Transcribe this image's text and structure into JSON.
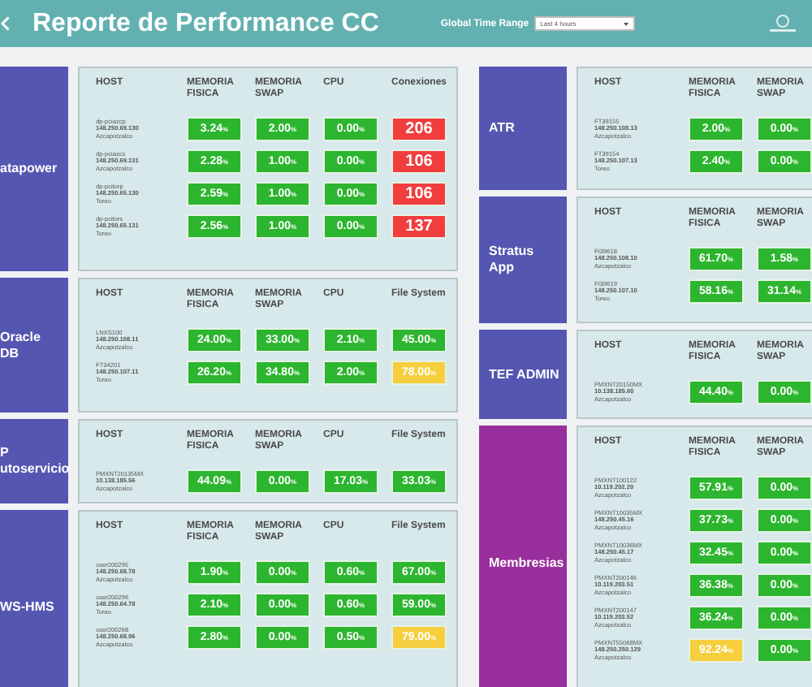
{
  "header": {
    "title": "Reporte de Performance CC",
    "time_range": {
      "label": "Global Time Range",
      "value": "Last 4 hours"
    }
  },
  "left_groups": [
    {
      "label": [
        "atapower"
      ],
      "color": "#5456b1",
      "columns": [
        "HOST",
        "MEMORIA FISICA",
        "MEMORIA SWAP",
        "CPU",
        "Conexiones"
      ],
      "rows": [
        {
          "host": "dp-pciazcp",
          "ip": "148.250.69.130",
          "site": "Azcapotzalco",
          "values": [
            {
              "value": "3.24",
              "unit": "%",
              "color": "#2cb52e"
            },
            {
              "value": "2.00",
              "unit": "%",
              "color": "#2cb52e"
            },
            {
              "value": "0.00",
              "unit": "%",
              "color": "#2cb52e"
            },
            {
              "value": "206",
              "color": "#f23d3f"
            }
          ]
        },
        {
          "host": "dp-pciazcs",
          "ip": "148.250.69.131",
          "site": "Azcapotzalco",
          "values": [
            {
              "value": "2.28",
              "unit": "%",
              "color": "#2cb52e"
            },
            {
              "value": "1.00",
              "unit": "%",
              "color": "#2cb52e"
            },
            {
              "value": "0.00",
              "unit": "%",
              "color": "#2cb52e"
            },
            {
              "value": "106",
              "color": "#f23d3f"
            }
          ]
        },
        {
          "host": "dp-pcitorp",
          "ip": "148.250.65.130",
          "site": "Toreo",
          "values": [
            {
              "value": "2.59",
              "unit": "%",
              "color": "#2cb52e"
            },
            {
              "value": "1.00",
              "unit": "%",
              "color": "#2cb52e"
            },
            {
              "value": "0.00",
              "unit": "%",
              "color": "#2cb52e"
            },
            {
              "value": "106",
              "color": "#f23d3f"
            }
          ]
        },
        {
          "host": "dp-pcitors",
          "ip": "148.250.65.131",
          "site": "Toreo",
          "values": [
            {
              "value": "2.56",
              "unit": "%",
              "color": "#2cb52e"
            },
            {
              "value": "1.00",
              "unit": "%",
              "color": "#2cb52e"
            },
            {
              "value": "0.00",
              "unit": "%",
              "color": "#2cb52e"
            },
            {
              "value": "137",
              "color": "#f23d3f"
            }
          ]
        }
      ]
    },
    {
      "label": [
        "Oracle",
        "DB"
      ],
      "color": "#5456b1",
      "columns": [
        "HOST",
        "MEMORIA FISICA",
        "MEMORIA SWAP",
        "CPU",
        "File System"
      ],
      "rows": [
        {
          "host": "LNXS100",
          "ip": "148.250.108.11",
          "site": "Azcapotzalco",
          "values": [
            {
              "value": "24.00",
              "unit": "%",
              "color": "#2cb52e"
            },
            {
              "value": "33.00",
              "unit": "%",
              "color": "#2cb52e"
            },
            {
              "value": "2.10",
              "unit": "%",
              "color": "#2cb52e"
            },
            {
              "value": "45.00",
              "unit": "%",
              "color": "#2cb52e"
            }
          ]
        },
        {
          "host": "FT34201",
          "ip": "148.250.107.11",
          "site": "Toreo",
          "values": [
            {
              "value": "26.20",
              "unit": "%",
              "color": "#2cb52e"
            },
            {
              "value": "34.80",
              "unit": "%",
              "color": "#2cb52e"
            },
            {
              "value": "2.00",
              "unit": "%",
              "color": "#2cb52e"
            },
            {
              "value": "78.00",
              "unit": "%",
              "color": "#f6cf3f"
            }
          ]
        }
      ]
    },
    {
      "label": [
        "P",
        "utoservicio"
      ],
      "color": "#5456b1",
      "columns": [
        "HOST",
        "MEMORIA FISICA",
        "MEMORIA SWAP",
        "CPU",
        "File System"
      ],
      "rows": [
        {
          "host": "PMXNT20135MX",
          "ip": "10.138.185.56",
          "site": "Azcapotzalco",
          "values": [
            {
              "value": "44.09",
              "unit": "%",
              "color": "#2cb52e"
            },
            {
              "value": "0.00",
              "unit": "%",
              "color": "#2cb52e"
            },
            {
              "value": "17.03",
              "unit": "%",
              "color": "#2cb52e"
            },
            {
              "value": "33.03",
              "unit": "%",
              "color": "#2cb52e"
            }
          ]
        }
      ]
    },
    {
      "label": [
        "WS-HMS"
      ],
      "color": "#5456b1",
      "columns": [
        "HOST",
        "MEMORIA FISICA",
        "MEMORIA SWAP",
        "CPU",
        "File System"
      ],
      "rows": [
        {
          "host": "oser200295",
          "ip": "148.250.68.78",
          "site": "Azcapotzalco",
          "values": [
            {
              "value": "1.90",
              "unit": "%",
              "color": "#2cb52e"
            },
            {
              "value": "0.00",
              "unit": "%",
              "color": "#2cb52e"
            },
            {
              "value": "0.60",
              "unit": "%",
              "color": "#2cb52e"
            },
            {
              "value": "67.00",
              "unit": "%",
              "color": "#2cb52e"
            }
          ]
        },
        {
          "host": "oser200296",
          "ip": "148.250.64.78",
          "site": "Toreo",
          "values": [
            {
              "value": "2.10",
              "unit": "%",
              "color": "#2cb52e"
            },
            {
              "value": "0.00",
              "unit": "%",
              "color": "#2cb52e"
            },
            {
              "value": "0.60",
              "unit": "%",
              "color": "#2cb52e"
            },
            {
              "value": "59.00",
              "unit": "%",
              "color": "#2cb52e"
            }
          ]
        },
        {
          "host": "oser200268",
          "ip": "148.250.68.96",
          "site": "Azcapotzalco",
          "values": [
            {
              "value": "2.80",
              "unit": "%",
              "color": "#2cb52e"
            },
            {
              "value": "0.00",
              "unit": "%",
              "color": "#2cb52e"
            },
            {
              "value": "0.50",
              "unit": "%",
              "color": "#2cb52e"
            },
            {
              "value": "79.00",
              "unit": "%",
              "color": "#f6cf3f"
            }
          ]
        }
      ]
    }
  ],
  "right_groups": [
    {
      "label": [
        "ATR"
      ],
      "color": "#5456b1",
      "columns": [
        "HOST",
        "MEMORIA FISICA",
        "MEMORIA SWAP"
      ],
      "rows": [
        {
          "host": "FT39155",
          "ip": "148.250.108.13",
          "site": "Azcapotzalco",
          "values": [
            {
              "value": "2.00",
              "unit": "%",
              "color": "#2cb52e"
            },
            {
              "value": "0.00",
              "unit": "%",
              "color": "#2cb52e"
            }
          ]
        },
        {
          "host": "FT39154",
          "ip": "148.250.107.13",
          "site": "Toreo",
          "values": [
            {
              "value": "2.40",
              "unit": "%",
              "color": "#2cb52e"
            },
            {
              "value": "0.00",
              "unit": "%",
              "color": "#2cb52e"
            }
          ]
        }
      ]
    },
    {
      "label": [
        "Stratus",
        "App"
      ],
      "color": "#5456b1",
      "columns": [
        "HOST",
        "MEMORIA FISICA",
        "MEMORIA SWAP"
      ],
      "rows": [
        {
          "host": "FI39618",
          "ip": "148.250.108.10",
          "site": "Azcapotzalco",
          "values": [
            {
              "value": "61.70",
              "unit": "%",
              "color": "#2cb52e"
            },
            {
              "value": "1.58",
              "unit": "%",
              "color": "#2cb52e"
            }
          ]
        },
        {
          "host": "FI39619",
          "ip": "148.250.107.10",
          "site": "Toreo",
          "values": [
            {
              "value": "58.16",
              "unit": "%",
              "color": "#2cb52e"
            },
            {
              "value": "31.14",
              "unit": "%",
              "color": "#2cb52e"
            }
          ]
        }
      ]
    },
    {
      "label": [
        "TEF ADMIN"
      ],
      "color": "#5456b1",
      "columns": [
        "HOST",
        "MEMORIA FISICA",
        "MEMORIA SWAP"
      ],
      "rows": [
        {
          "host": "PMXNT20150MX",
          "ip": "10.138.185.60",
          "site": "Azcapotzalco",
          "values": [
            {
              "value": "44.40",
              "unit": "%",
              "color": "#2cb52e"
            },
            {
              "value": "0.00",
              "unit": "%",
              "color": "#2cb52e"
            }
          ]
        }
      ]
    },
    {
      "label": [
        "Membresias"
      ],
      "color": "#992f9c",
      "columns": [
        "HOST",
        "MEMORIA FISICA",
        "MEMORIA SWAP"
      ],
      "rows": [
        {
          "host": "PMXNT100122",
          "ip": "10.119.202.20",
          "site": "Azcapotzalco",
          "values": [
            {
              "value": "57.91",
              "unit": "%",
              "color": "#2cb52e"
            },
            {
              "value": "0.00",
              "unit": "%",
              "color": "#2cb52e"
            }
          ]
        },
        {
          "host": "PMXNT10035MX",
          "ip": "148.250.45.16",
          "site": "Azcapotzalco",
          "values": [
            {
              "value": "37.73",
              "unit": "%",
              "color": "#2cb52e"
            },
            {
              "value": "0.00",
              "unit": "%",
              "color": "#2cb52e"
            }
          ]
        },
        {
          "host": "PMXNT10036MX",
          "ip": "148.250.45.17",
          "site": "Azcapotzalco",
          "values": [
            {
              "value": "32.45",
              "unit": "%",
              "color": "#2cb52e"
            },
            {
              "value": "0.00",
              "unit": "%",
              "color": "#2cb52e"
            }
          ]
        },
        {
          "host": "PMXNT200146",
          "ip": "10.119.203.51",
          "site": "Azcapotzalco",
          "values": [
            {
              "value": "36.38",
              "unit": "%",
              "color": "#2cb52e"
            },
            {
              "value": "0.00",
              "unit": "%",
              "color": "#2cb52e"
            }
          ]
        },
        {
          "host": "PMXNT200147",
          "ip": "10.119.203.52",
          "site": "Azcapotzalco",
          "values": [
            {
              "value": "36.24",
              "unit": "%",
              "color": "#2cb52e"
            },
            {
              "value": "0.00",
              "unit": "%",
              "color": "#2cb52e"
            }
          ]
        },
        {
          "host": "PMXNT55068MX",
          "ip": "148.250.250.129",
          "site": "Azcapotzalco",
          "values": [
            {
              "value": "92.24",
              "unit": "%",
              "color": "#f6cf3f"
            },
            {
              "value": "0.00",
              "unit": "%",
              "color": "#2cb52e"
            }
          ]
        }
      ]
    }
  ]
}
